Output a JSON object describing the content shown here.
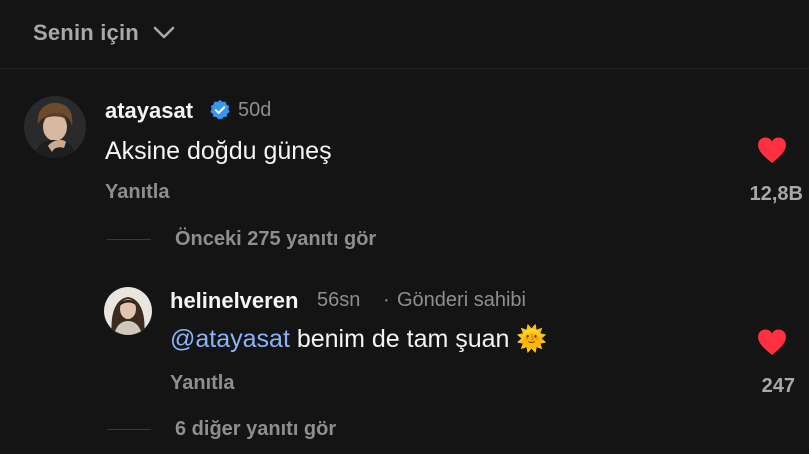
{
  "header": {
    "sort_label": "Senin için",
    "sort_icon": "chevron-down-icon"
  },
  "comments": [
    {
      "username": "atayasat",
      "verified": true,
      "time": "50d",
      "text": "Aksine doğdu güneş",
      "reply_label": "Yanıtla",
      "liked": true,
      "like_count": "12,8B",
      "view_replies": "Önceki 275 yanıtı gör"
    }
  ],
  "reply": {
    "username": "helinelveren",
    "time": "56sn",
    "separator": "·",
    "author_badge": "Gönderi sahibi",
    "mention": "@atayasat",
    "text": " benim de tam şuan ",
    "emoji": "🌞",
    "reply_label": "Yanıtla",
    "liked": true,
    "like_count": "247",
    "view_more": "6 diğer yanıtı gör"
  },
  "colors": {
    "background": "#141414",
    "heart": "#ff3040",
    "mention": "#8ab4f8",
    "verified": "#3897f0",
    "muted_text": "#8e8e8e"
  }
}
